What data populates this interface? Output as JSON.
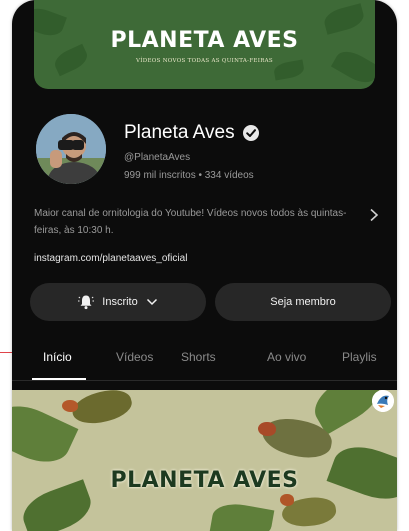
{
  "banner": {
    "title": "PLANETA AVES",
    "subtitle": "VÍDEOS NOVOS TODAS AS QUINTA-FEIRAS"
  },
  "channel": {
    "name": "Planeta Aves",
    "handle": "@PlanetaAves",
    "stats": "999 mil inscritos • 334 vídeos",
    "description": "Maior canal de ornitologia do Youtube! Vídeos novos todos às quintas-feiras, às 10:30 h.",
    "link": "instagram.com/planetaaves_oficial"
  },
  "buttons": {
    "subscribed_label": "Inscrito",
    "member_label": "Seja membro"
  },
  "tabs": [
    {
      "label": "Início",
      "active": true
    },
    {
      "label": "Vídeos",
      "active": false
    },
    {
      "label": "Shorts",
      "active": false
    },
    {
      "label": "Ao vivo",
      "active": false
    },
    {
      "label": "Playlis",
      "active": false
    }
  ],
  "thumbnail": {
    "title": "PLANETA AVES"
  },
  "icons": {
    "verified": "verified-check-icon",
    "bell": "bell-icon",
    "chevron_down": "chevron-down-icon",
    "chevron_right": "chevron-right-icon"
  },
  "colors": {
    "background": "#0c0c0c",
    "banner_green": "#3e6a37",
    "button_bg": "#272727",
    "text_primary": "#ffffff",
    "text_secondary": "#9a9a9a"
  }
}
